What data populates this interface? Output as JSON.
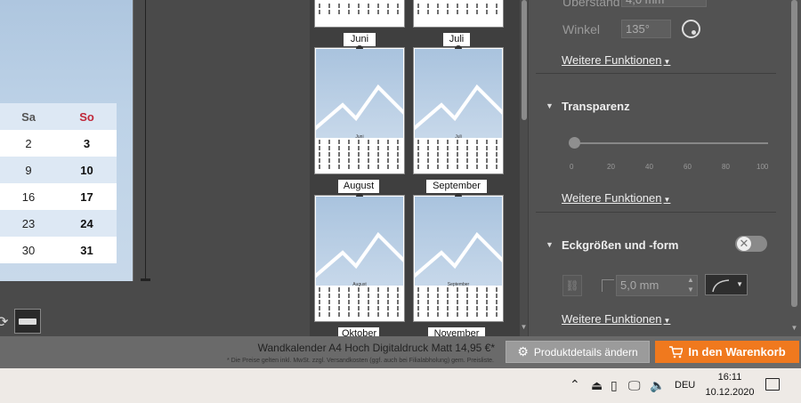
{
  "calendar_preview": {
    "headers": [
      "Sa",
      "So"
    ],
    "rows": [
      [
        "2",
        "3"
      ],
      [
        "9",
        "10"
      ],
      [
        "16",
        "17"
      ],
      [
        "23",
        "24"
      ],
      [
        "30",
        "31"
      ]
    ]
  },
  "pages": {
    "top_labels": [
      "Juni",
      "Juli"
    ],
    "thumbs": [
      {
        "title": "Juni",
        "label": "August"
      },
      {
        "title": "Juli",
        "label": "September"
      },
      {
        "title": "August",
        "label": "Oktober"
      },
      {
        "title": "September",
        "label": "November"
      }
    ]
  },
  "properties": {
    "ueberstand_label": "Überstand",
    "ueberstand_value": "4,0 mm",
    "winkel_label": "Winkel",
    "winkel_value": "135°",
    "more_functions": "Weitere Funktionen",
    "transparency_title": "Transparenz",
    "slider_ticks": [
      "0",
      "20",
      "40",
      "60",
      "80",
      "100"
    ],
    "transparency_value": 0,
    "corners_title": "Eckgrößen und -form",
    "corner_value": "5,0 mm"
  },
  "footer": {
    "product": "Wandkalender A4 Hoch Digitaldruck Matt 14,95 €*",
    "disclaimer": "* Die Preise gelten inkl. MwSt. zzgl. Versandkosten (ggf. auch bei Filialabholung) gem. Preisliste.",
    "details_button": "Produktdetails ändern",
    "cart_button": "In den Warenkorb"
  },
  "taskbar": {
    "language": "DEU",
    "time": "16:11",
    "date": "10.12.2020"
  },
  "colors": {
    "accent": "#f0791e",
    "sunday": "#c0283a"
  }
}
